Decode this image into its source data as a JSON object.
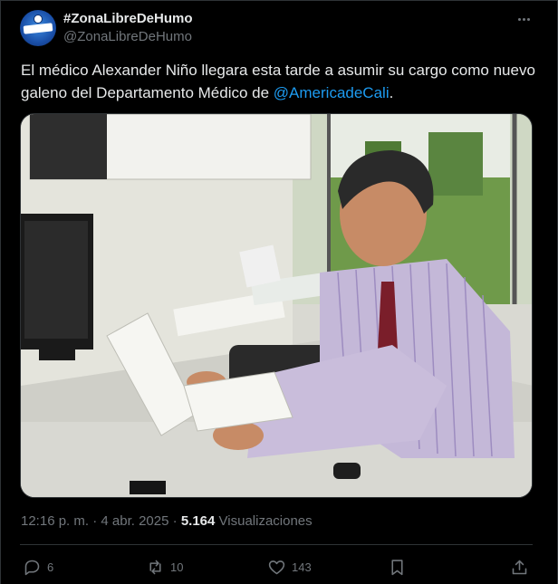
{
  "author": {
    "display_name": "#ZonaLibreDeHumo",
    "handle": "@ZonaLibreDeHumo",
    "avatar_icon": "soccer-club-logo-icon"
  },
  "tweet": {
    "text_before": "El médico Alexander Niño llegara esta tarde a asumir su cargo como nuevo galeno del Departamento Médico de ",
    "mention": "@AmericadeCali",
    "text_after": ".",
    "media_icon": "photo-man-reading-document-at-desk"
  },
  "meta": {
    "time": "12:16 p. m.",
    "separator": " · ",
    "date": "4 abr. 2025",
    "views_count": "5.164",
    "views_label": "Visualizaciones"
  },
  "actions": {
    "replies": "6",
    "reposts": "10",
    "likes": "143"
  },
  "colors": {
    "background": "#000000",
    "text": "#e7e9ea",
    "secondary": "#71767b",
    "link": "#1d9bf0",
    "border": "#2f3336"
  }
}
